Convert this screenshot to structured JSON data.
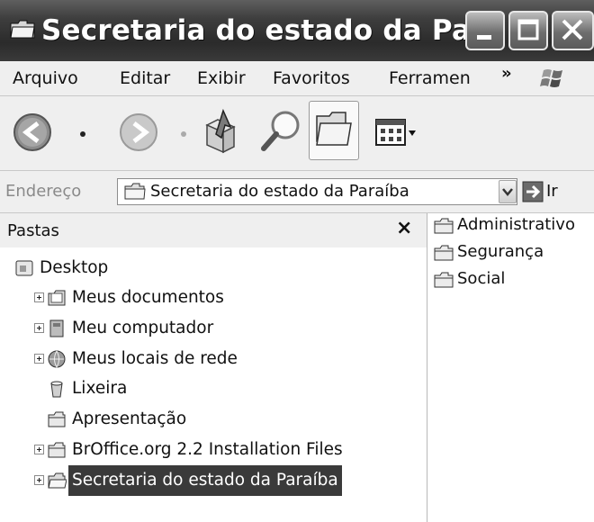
{
  "window": {
    "title": "Secretaria do estado da Par.."
  },
  "menu": {
    "items": [
      "Arquivo",
      "Editar",
      "Exibir",
      "Favoritos",
      "Ferramen"
    ],
    "overflow": "»"
  },
  "toolbar": {
    "buttons": [
      "back-icon",
      "forward-icon",
      "up-folder-icon",
      "search-icon",
      "folders-icon",
      "views-icon"
    ]
  },
  "address": {
    "label": "Endereço",
    "value": "Secretaria do estado da Paraíba",
    "go": "Ir"
  },
  "folders_pane": {
    "title": "Pastas",
    "close": "×",
    "tree": [
      {
        "label": "Desktop"
      },
      {
        "label": "Meus documentos"
      },
      {
        "label": "Meu computador"
      },
      {
        "label": "Meus locais de rede"
      },
      {
        "label": "Lixeira"
      },
      {
        "label": "Apresentação"
      },
      {
        "label": "BrOffice.org 2.2 Installation Files"
      },
      {
        "label": "Secretaria do estado da Paraíba"
      }
    ]
  },
  "files": [
    "Administrativo",
    "Segurança",
    "Social"
  ]
}
